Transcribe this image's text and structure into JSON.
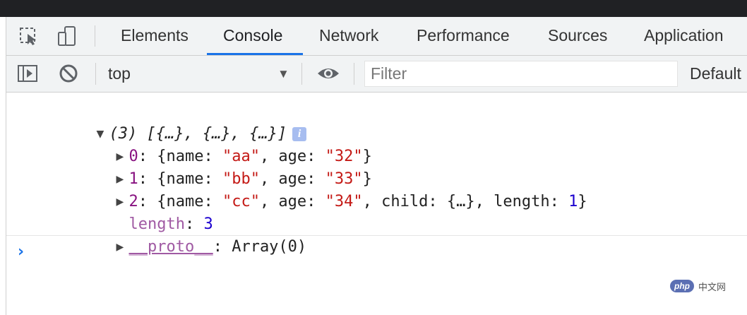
{
  "toolbar": {
    "inspect_icon": "inspect-element-icon",
    "device_icon": "device-toolbar-icon"
  },
  "tabs": [
    {
      "label": "Elements",
      "active": false
    },
    {
      "label": "Console",
      "active": true
    },
    {
      "label": "Network",
      "active": false
    },
    {
      "label": "Performance",
      "active": false
    },
    {
      "label": "Sources",
      "active": false
    },
    {
      "label": "Application",
      "active": false
    }
  ],
  "console_toolbar": {
    "sidebar_icon": "show-sidebar-icon",
    "clear_icon": "clear-console-icon",
    "context": "top",
    "eye_icon": "live-expression-icon",
    "filter_placeholder": "Filter",
    "levels": "Default"
  },
  "output": {
    "summary": "(3) [{…}, {…}, {…}]",
    "info_badge": "i",
    "items": [
      {
        "index": "0",
        "name": "\"aa\"",
        "age": "\"32\""
      },
      {
        "index": "1",
        "name": "\"bb\"",
        "age": "\"33\""
      },
      {
        "index": "2",
        "name": "\"cc\"",
        "age": "\"34\"",
        "child": "{…}",
        "length": "1"
      }
    ],
    "length_label": "length",
    "length_value": "3",
    "proto_label": "__proto__",
    "proto_value": "Array(0)"
  },
  "prompt_glyph": "›",
  "watermark": {
    "logo": "php",
    "text": "中文网"
  },
  "colors": {
    "accent": "#1a73e8",
    "property_key": "#881280",
    "string": "#c41a16",
    "number": "#1c00cf",
    "toolbar_bg": "#f1f3f4"
  }
}
